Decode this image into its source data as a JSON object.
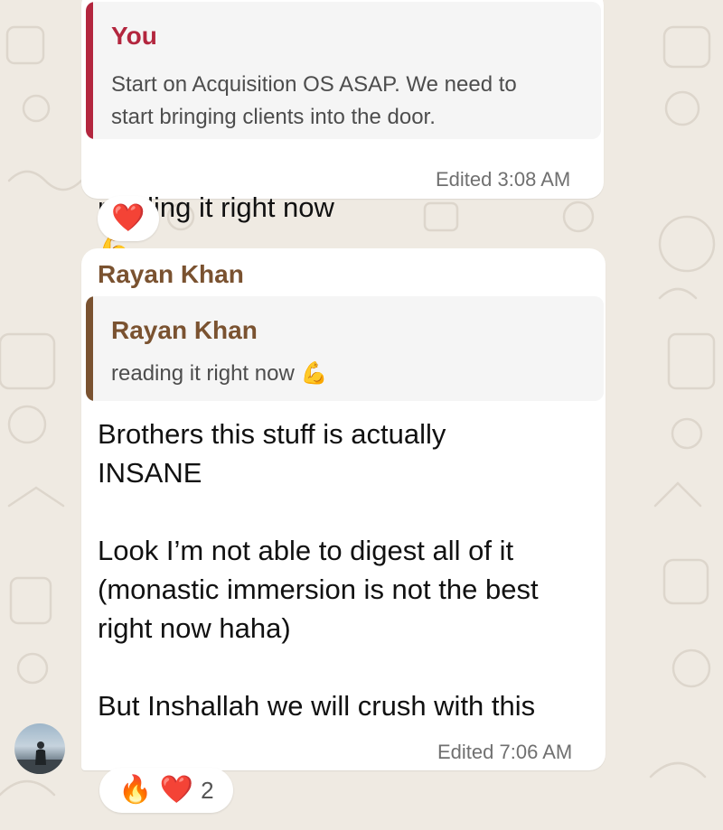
{
  "messages": [
    {
      "quote": {
        "name": "You",
        "text": "Start on Acquisition OS ASAP. We need to\nstart bringing clients into the door."
      },
      "text": "reading it right now",
      "text_emoji": "💪",
      "meta": "Edited 3:08 AM",
      "reactions": [
        {
          "emoji": "❤️"
        }
      ]
    },
    {
      "sender": "Rayan Khan",
      "quote": {
        "name": "Rayan Khan",
        "text": "reading it right now",
        "text_emoji": "💪"
      },
      "text": "Brothers this stuff is actually\nINSANE\n\nLook I’m not able to digest all of it\n(monastic immersion is not the best\nright now haha)\n\nBut Inshallah we will crush with this",
      "meta": "Edited 7:06 AM",
      "reactions": [
        {
          "emoji": "🔥"
        },
        {
          "emoji": "❤️"
        }
      ],
      "reaction_count": "2"
    }
  ],
  "colors": {
    "background": "#efeae2",
    "you_accent": "#b3263e",
    "rayan_accent": "#7a5230",
    "quote_bg": "#f5f5f5",
    "meta": "#707070"
  }
}
